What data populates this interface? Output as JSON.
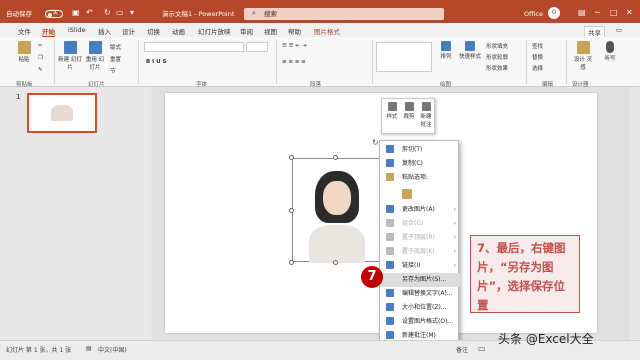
{
  "titlebar": {
    "autosave_label": "自动保存",
    "autosave_state": "关",
    "doc_title": "演示文稿1 - PowerPoint",
    "search_placeholder": "搜索",
    "user_name": "Office",
    "contextual_tab": "图片格式",
    "share_label": "共享",
    "accent_color": "#b7472a"
  },
  "tabs": [
    "文件",
    "开始",
    "iSlide",
    "插入",
    "设计",
    "切换",
    "动画",
    "幻灯片放映",
    "审阅",
    "视图",
    "帮助",
    "图片格式"
  ],
  "active_tab": "开始",
  "ribbon": {
    "paste": "粘贴",
    "new_slide": "新建\n幻灯片",
    "reuse": "重用\n幻灯片",
    "layout": "版式",
    "reset": "重置",
    "section": "节",
    "arrange": "排列",
    "quick_styles": "快速样式",
    "shape_fill": "形状填充",
    "shape_outline": "形状轮廓",
    "shape_effect": "形状效果",
    "find": "查找",
    "replace": "替换",
    "select": "选择",
    "designer": "设计\n灵感",
    "dictate": "听写",
    "groups": [
      "剪贴板",
      "幻灯片",
      "字体",
      "段落",
      "绘图",
      "编辑",
      "设计器"
    ]
  },
  "mini_toolbar": [
    "样式",
    "裁剪",
    "新建\n批注"
  ],
  "slide_number": "1",
  "context_menu": [
    {
      "label": "剪切(T)",
      "state": "normal",
      "icon": "scissors-icon"
    },
    {
      "label": "复制(C)",
      "state": "normal",
      "icon": "copy-icon"
    },
    {
      "label": "粘贴选项:",
      "state": "normal",
      "icon": "paste-icon"
    },
    {
      "label": "",
      "state": "normal",
      "icon": "paste-options-icon"
    },
    {
      "label": "更改图片(A)",
      "state": "normal",
      "icon": "change-picture-icon",
      "submenu": true
    },
    {
      "label": "组合(G)",
      "state": "disabled",
      "icon": "group-icon",
      "submenu": true
    },
    {
      "label": "置于顶层(R)",
      "state": "disabled",
      "icon": "bring-front-icon",
      "submenu": true
    },
    {
      "label": "置于底层(K)",
      "state": "disabled",
      "icon": "send-back-icon",
      "submenu": true
    },
    {
      "label": "链接(I)",
      "state": "normal",
      "icon": "link-icon",
      "submenu": true
    },
    {
      "label": "另存为图片(S)...",
      "state": "highlight",
      "icon": ""
    },
    {
      "label": "编辑替换文字(A)...",
      "state": "normal",
      "icon": "alt-text-icon"
    },
    {
      "label": "大小和位置(Z)...",
      "state": "normal",
      "icon": "size-icon"
    },
    {
      "label": "设置图片格式(O)...",
      "state": "normal",
      "icon": "format-picture-icon"
    },
    {
      "label": "新建批注(M)",
      "state": "normal",
      "icon": "comment-icon"
    }
  ],
  "step_badge": "7",
  "callout": "7、最后，右键图片，“另存为图片”，选择保存位置",
  "status": {
    "slide_info": "幻灯片 第 1 张，共 1 张",
    "language": "中文(中国)",
    "notes": "备注"
  },
  "watermark": "头条 @Excel大全"
}
